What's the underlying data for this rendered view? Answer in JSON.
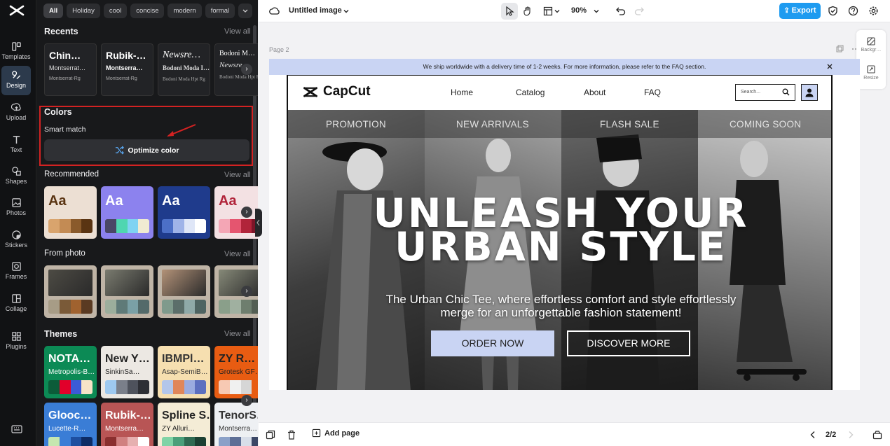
{
  "left_rail": {
    "items": [
      {
        "label": "Templates"
      },
      {
        "label": "Design"
      },
      {
        "label": "Upload"
      },
      {
        "label": "Text"
      },
      {
        "label": "Shapes"
      },
      {
        "label": "Photos"
      },
      {
        "label": "Stickers"
      },
      {
        "label": "Frames"
      },
      {
        "label": "Collage"
      },
      {
        "label": "Plugins"
      }
    ],
    "active": "Design"
  },
  "panel": {
    "chips": [
      "All",
      "Holiday",
      "cool",
      "concise",
      "modern",
      "formal"
    ],
    "recents": {
      "title": "Recents",
      "view_all": "View all",
      "cards": [
        {
          "font1": "Chin…",
          "font2": "Montserrat…",
          "font3": "Montserrat-Rg"
        },
        {
          "font1": "Rubik-…",
          "font2": "Montserra…",
          "font3": "Montserrat-Rg"
        },
        {
          "font1": "Newsre…",
          "font2": "Bodoni Moda I…",
          "font3": "Bodoni Moda Hpt Rg"
        },
        {
          "font1": "Bodoni M…",
          "font2": "Newsre…",
          "font3": "Bodoni Moda Hpt Rg"
        }
      ]
    },
    "colors": {
      "title": "Colors",
      "smart_match": "Smart match",
      "optimize_label": "Optimize color"
    },
    "recommended": {
      "title": "Recommended",
      "view_all": "View all",
      "cards": [
        {
          "aa": "Aa",
          "bg": "#ecdfd3",
          "fg": "#5a3412",
          "swatches": [
            "#d9a46d",
            "#c38b54",
            "#8a5a2b",
            "#5a3412"
          ]
        },
        {
          "aa": "Aa",
          "bg": "#8c82ee",
          "fg": "#ffffff",
          "swatches": [
            "#4a4766",
            "#4fd6b0",
            "#7fd3f2",
            "#f0ebd2"
          ]
        },
        {
          "aa": "Aa",
          "bg": "#1f3b8c",
          "fg": "#ffffff",
          "swatches": [
            "#4c6fc7",
            "#9fb3e8",
            "#dfe6f7",
            "#ffffff"
          ]
        },
        {
          "aa": "Aa",
          "bg": "#f3e1e3",
          "fg": "#b1243a",
          "swatches": [
            "#f4a6b5",
            "#e5556f",
            "#b1243a",
            "#7c1528"
          ]
        }
      ]
    },
    "from_photo": {
      "title": "From photo",
      "view_all": "View all",
      "cards": [
        {
          "img": "#4d4b44",
          "swatches": [
            "#a79c86",
            "#7a5a38",
            "#a0622f",
            "#5a3a22"
          ]
        },
        {
          "img": "#7a7b6f",
          "swatches": [
            "#9cae9c",
            "#5f7a78",
            "#7aa0a6",
            "#536a6a"
          ]
        },
        {
          "img": "#b39278",
          "swatches": [
            "#7f9a8c",
            "#5b6e6a",
            "#8fa9a8",
            "#4f6462"
          ]
        },
        {
          "img": "#868978",
          "swatches": [
            "#8a9f8a",
            "#a0b0a0",
            "#6e7e6e",
            "#535e53"
          ]
        }
      ]
    },
    "themes": {
      "title": "Themes",
      "view_all": "View all",
      "cards": [
        {
          "t1": "NOTA…",
          "t2": "Metropolis-B…",
          "bg": "#0c8a55",
          "fg": "#ffffff",
          "swatches": [
            "#0b5c39",
            "#e2002a",
            "#3b5bd6",
            "#f7e3c7"
          ]
        },
        {
          "t1": "New Y…",
          "t2": "SinkinSa…",
          "bg": "#ece8e3",
          "fg": "#222222",
          "swatches": [
            "#9ec9f0",
            "#7a7f8a",
            "#4e525c",
            "#2d2f35"
          ]
        },
        {
          "t1": "IBMPl…",
          "t2": "Asap-SemiB…",
          "bg": "#f6dfb0",
          "fg": "#333333",
          "swatches": [
            "#b3c6ea",
            "#e0865a",
            "#9babe0",
            "#5d6fbf"
          ]
        },
        {
          "t1": "ZY R…",
          "t2": "Grotesk GF…",
          "bg": "#e85c12",
          "fg": "#222222",
          "swatches": [
            "#f7c9b3",
            "#f0f0f0",
            "#d6d6d6",
            "#e85c12"
          ]
        },
        {
          "t1": "Glooc…",
          "t2": "Lucette-R…",
          "bg": "#3a7dd6",
          "fg": "#ffffff",
          "swatches": [
            "#c5e7b0",
            "#3a7dd6",
            "#1e4fa0",
            "#0d2c66"
          ]
        },
        {
          "t1": "Rubik-…",
          "t2": "Montserra…",
          "bg": "#b85555",
          "fg": "#ffffff",
          "swatches": [
            "#8a2f2f",
            "#d08080",
            "#e6b0b0",
            "#ffffff"
          ]
        },
        {
          "t1": "Spline S…",
          "t2": "ZY Alluri…",
          "bg": "#f4ecd6",
          "fg": "#222222",
          "swatches": [
            "#7fd3a6",
            "#4a9f7a",
            "#2f6a52",
            "#1b4033"
          ]
        },
        {
          "t1": "TenorS…",
          "t2": "Montserra…",
          "bg": "#eef0f3",
          "fg": "#333333",
          "swatches": [
            "#8aa0c8",
            "#5d6e96",
            "#d8dee9",
            "#3b4766"
          ]
        }
      ]
    }
  },
  "topbar": {
    "title": "Untitled image",
    "zoom": "90%",
    "export_label": "Export"
  },
  "canvas": {
    "page_label": "Page 2",
    "side_tools": [
      "Backgr…",
      "Resize"
    ],
    "announcement": "We ship worldwide with a delivery time of 1-2 weeks. For more information, please refer to the FAQ section.",
    "brand": "CapCut",
    "nav": [
      "Home",
      "Catalog",
      "About",
      "FAQ"
    ],
    "search_placeholder": "Search...",
    "categories": [
      "PROMOTION",
      "NEW ARRIVALS",
      "FLASH SALE",
      "COMING SOON"
    ],
    "headline_line1": "UNLEASH YOUR",
    "headline_line2": "URBAN STYLE",
    "subline_line1": "The Urban Chic Tee, where effortless comfort and style effortlessly",
    "subline_line2": "merge for an unforgettable fashion statement!",
    "order_label": "ORDER NOW",
    "discover_label": "DISCOVER MORE"
  },
  "bottombar": {
    "add_page_label": "Add page",
    "pager": "2/2"
  }
}
